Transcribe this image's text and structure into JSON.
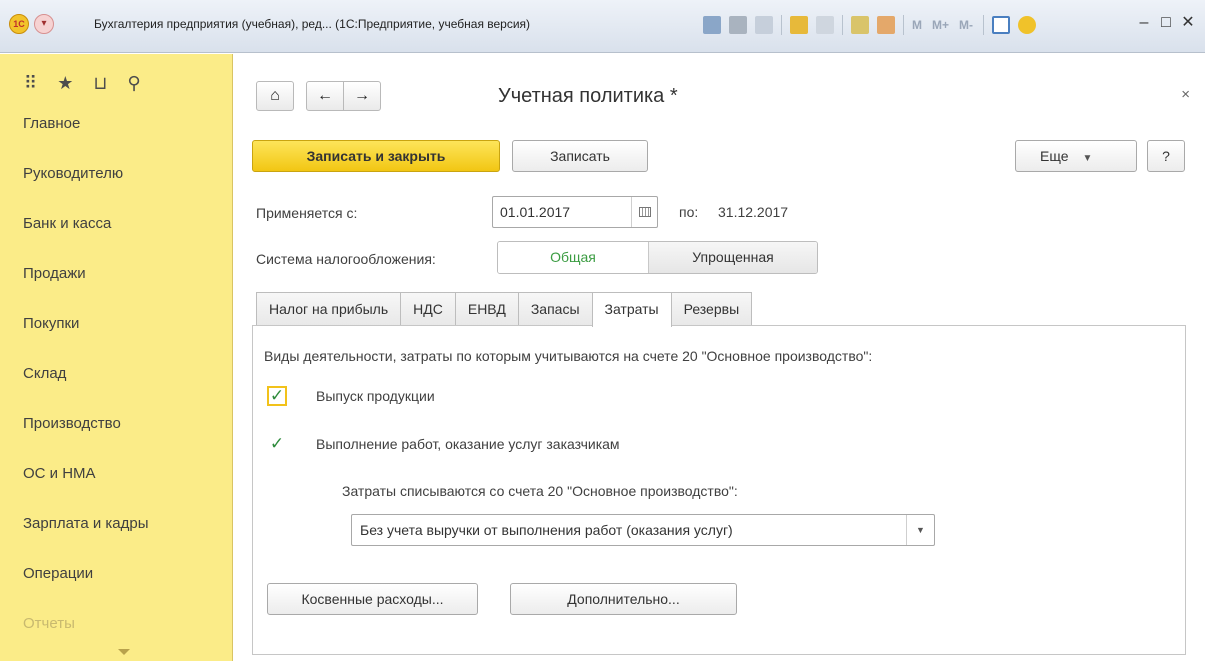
{
  "titlebar": {
    "title": "Бухгалтерия предприятия (учебная), ред... (1С:Предприятие, учебная версия)",
    "memory_buttons": [
      "M",
      "M+",
      "M-"
    ],
    "info_icon": "info-icon",
    "minimize": "–",
    "maximize": "□",
    "close": "✕"
  },
  "sidebar": {
    "top_icons": [
      "apps-grid-icon",
      "favorites-star-icon",
      "history-icon",
      "search-icon"
    ],
    "items": [
      "Главное",
      "Руководителю",
      "Банк и касса",
      "Продажи",
      "Покупки",
      "Склад",
      "Производство",
      "ОС и НМА",
      "Зарплата и кадры",
      "Операции",
      "Отчеты"
    ]
  },
  "form": {
    "title": "Учетная политика *",
    "close": "×",
    "save_close_label": "Записать и закрыть",
    "save_label": "Записать",
    "more_label": "Еще",
    "help_label": "?",
    "applies_from_label": "Применяется с:",
    "applies_from_value": "01.01.2017",
    "to_label": "по:",
    "to_value": "31.12.2017",
    "tax_system_label": "Система налогообложения:",
    "tax_system_options": [
      "Общая",
      "Упрощенная"
    ],
    "tax_system_selected": "Общая",
    "tabs": [
      "Налог на прибыль",
      "НДС",
      "ЕНВД",
      "Запасы",
      "Затраты",
      "Резервы"
    ],
    "active_tab": "Затраты"
  },
  "costs_tab": {
    "activities_label": "Виды деятельности, затраты по которым учитываются на счете 20 \"Основное производство\":",
    "checkbox_products": "Выпуск продукции",
    "checkbox_products_checked": true,
    "checkbox_services": "Выполнение работ, оказание услуг заказчикам",
    "checkbox_services_checked": true,
    "writeoff_label": "Затраты списываются со счета 20 \"Основное производство\":",
    "writeoff_value": "Без учета выручки от выполнения работ (оказания услуг)",
    "indirect_button": "Косвенные расходы...",
    "additional_button": "Дополнительно..."
  },
  "colors": {
    "sidebar_bg": "#fbec88",
    "primary_button": "#f5cd1f",
    "selected_segment_text": "#3b9c42",
    "checkmark": "#2e8b3c"
  }
}
